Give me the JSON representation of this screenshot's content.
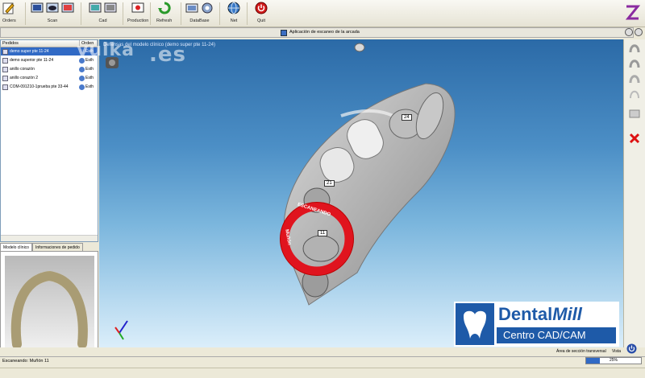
{
  "toolbar": {
    "orders": "Orders",
    "scan": "Scan",
    "cad": "Cad",
    "production": "Production",
    "refresh": "Refresh",
    "database": "DataBase",
    "net": "Net",
    "quit": "Quit"
  },
  "title_strip": {
    "title": "Aplicación de escaneo de la arcada"
  },
  "orders_panel": {
    "col_pedidos": "Pedidos",
    "col_orden": "Orden",
    "rows": [
      {
        "name": "demo super pte 11-24",
        "status": "Esth"
      },
      {
        "name": "demo superior pte 11-24",
        "status": "Esth"
      },
      {
        "name": "anillo corazón",
        "status": "Esth"
      },
      {
        "name": "anillo corazón 2",
        "status": "Esth"
      },
      {
        "name": "COM-091210-1prueba pte 33-44",
        "status": "Esth"
      }
    ]
  },
  "tabs": {
    "tab1": "Modelo clínico",
    "tab2": "Informaciones de pedido"
  },
  "viewport": {
    "title": "Defensas del modelo clínico (demo super pte 11-24)",
    "tooth_24": "24",
    "tooth_21": "21",
    "tooth_11": "11",
    "ring_text": "ESCANEANDO",
    "ring_sub": "Muñón"
  },
  "watermark": {
    "part1": "vulka",
    "part2": ".es"
  },
  "logo": {
    "brand1": "Dental",
    "brand2": "Mill",
    "subtitle": "Centro CAD/CAM"
  },
  "bottom": {
    "area_label": "Área de sección transversal",
    "view_label": "Vista"
  },
  "status": {
    "text": "Escaneando: Muñón 11",
    "progress_label": "25%",
    "progress": 0.25
  },
  "colors": {
    "accent": "#316ac5",
    "ring": "#e0141e",
    "logo_blue": "#1e5aa8"
  }
}
